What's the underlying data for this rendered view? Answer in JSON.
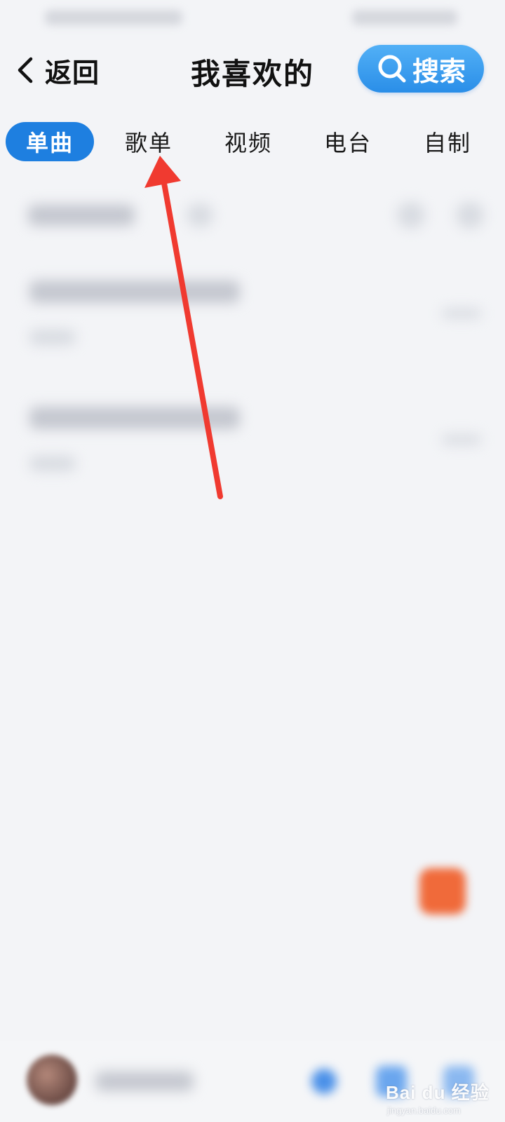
{
  "header": {
    "back_label": "返回",
    "title": "我喜欢的",
    "search_label": "搜索"
  },
  "tabs": [
    {
      "label": "单曲",
      "active": true
    },
    {
      "label": "歌单",
      "active": false
    },
    {
      "label": "视频",
      "active": false
    },
    {
      "label": "电台",
      "active": false
    },
    {
      "label": "自制",
      "active": false
    }
  ],
  "annotation": {
    "arrow_color": "#f03a30",
    "points_to": "歌单"
  },
  "colors": {
    "accent": "#1e7fe0",
    "search_button": "#3a9cf0",
    "fab": "#f06a3a",
    "background": "#f3f4f7"
  },
  "watermark": {
    "brand": "Bai du 经验",
    "url": "jingyan.baidu.com"
  }
}
